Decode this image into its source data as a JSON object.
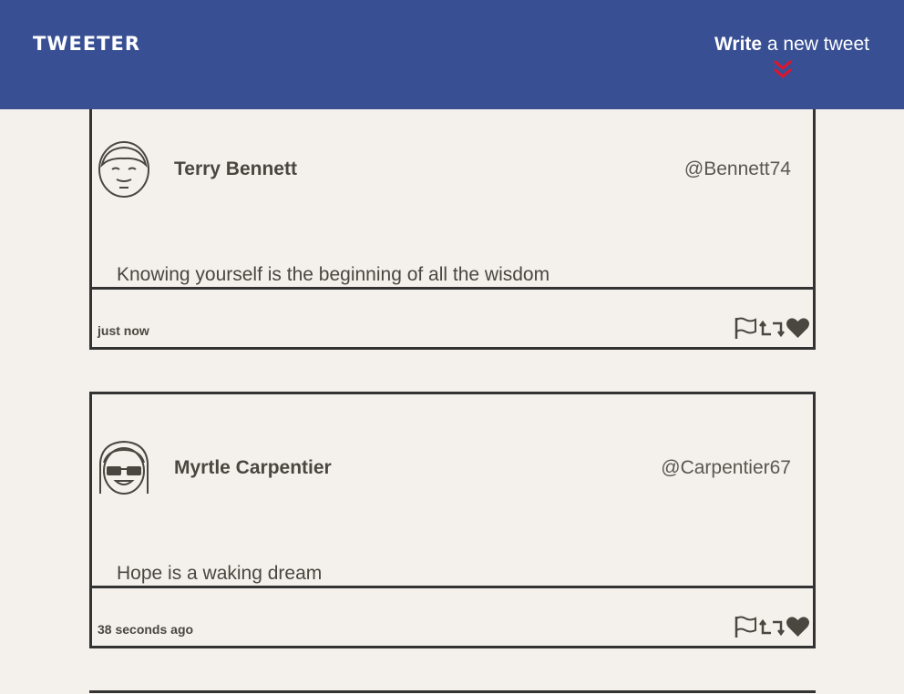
{
  "header": {
    "brand": "TWEETER",
    "compose_strong": "Write",
    "compose_light": "a new tweet"
  },
  "tweets": [
    {
      "name": "Terry Bennett",
      "handle": "@Bennett74",
      "content": "Knowing yourself is the beginning of all the wisdom",
      "time": "just now"
    },
    {
      "name": "Myrtle Carpentier",
      "handle": "@Carpentier67",
      "content": "Hope is a waking dream",
      "time": "38 seconds ago"
    }
  ],
  "colors": {
    "nav_background": "#384f94",
    "page_background": "#f4f1ec",
    "accent_chevron": "#e0142c",
    "border": "#333333",
    "text": "#4a4640"
  },
  "icons": {
    "compose_toggle": "double-chevron-down-icon",
    "flag": "flag-icon",
    "retweet": "retweet-icon",
    "like": "heart-icon"
  }
}
